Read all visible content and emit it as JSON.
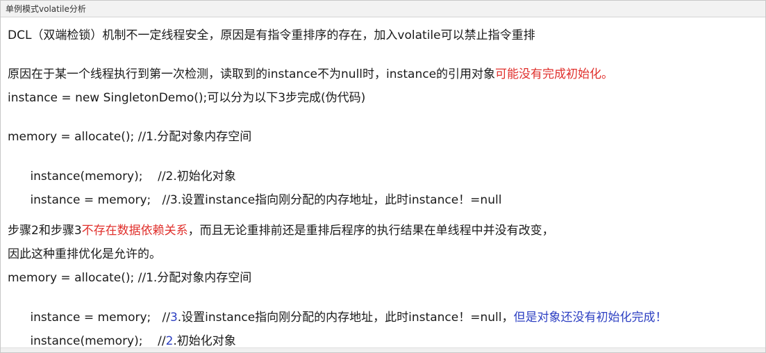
{
  "window": {
    "title": "单例模式volatile分析"
  },
  "lines": {
    "l1": "DCL（双端检锁）机制不一定线程安全，原因是有指令重排序的存在，加入volatile可以禁止指令重排",
    "l2a": "原因在于某一个线程执行到第一次检测，读取到的instance不为null时，instance的引用对象",
    "l2b": "可能没有完成初始化。",
    "l3": "instance = new SingletonDemo();可以分为以下3步完成(伪代码)",
    "l4": "memory = allocate(); //1.分配对象内存空间",
    "l5": "instance(memory);    //2.初始化对象",
    "l6": "instance = memory;   //3.设置instance指向刚分配的内存地址，此时instance！=null",
    "l7a": "步骤2和步骤3",
    "l7b": "不存在数据依赖关系",
    "l7c": "，而且无论重排前还是重排后程序的执行结果在单线程中并没有改变，",
    "l8": "因此这种重排优化是允许的。",
    "l9": "memory = allocate(); //1.分配对象内存空间",
    "l10a": "instance = memory;   //",
    "l10b": "3",
    "l10c": ".设置instance指向刚分配的内存地址，此时instance！=null，",
    "l10d": "但是对象还没有初始化完成！",
    "l11a": "instance(memory);    //",
    "l11b": "2",
    "l11c": ".初始化对象"
  },
  "colors": {
    "highlight_red": "#e0302c",
    "highlight_blue": "#2c3fc2"
  }
}
